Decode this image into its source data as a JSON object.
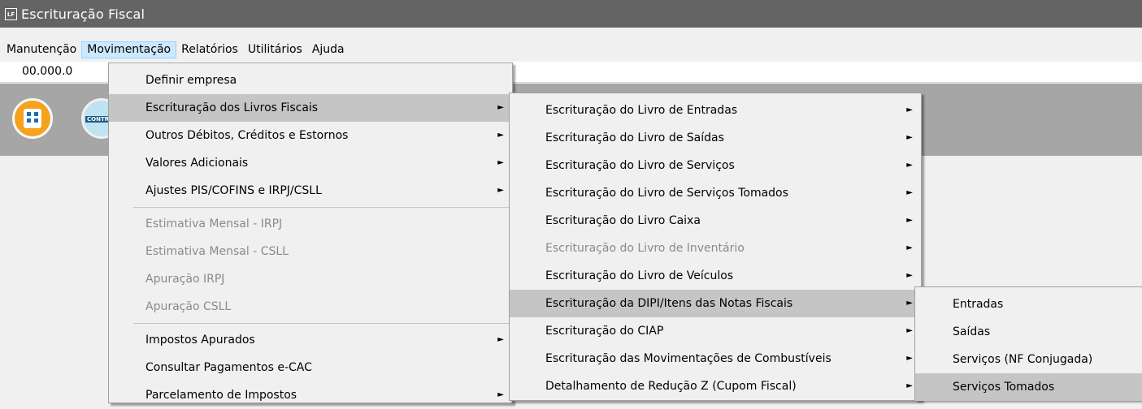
{
  "window": {
    "title": "Escrituração Fiscal",
    "icon_label": "LF"
  },
  "menubar": [
    "Manutenção",
    "Movimentação",
    "Relatórios",
    "Utilitários",
    "Ajuda"
  ],
  "company": {
    "cnpj_partial": "00.000.0"
  },
  "menu_movimentacao": [
    {
      "label": "Definir empresa",
      "submenu": false,
      "disabled": false
    },
    {
      "label": "Escrituração dos Livros Fiscais",
      "submenu": true,
      "disabled": false,
      "highlighted": true
    },
    {
      "label": "Outros Débitos, Créditos e Estornos",
      "submenu": true,
      "disabled": false
    },
    {
      "label": "Valores Adicionais",
      "submenu": true,
      "disabled": false
    },
    {
      "label": "Ajustes PIS/COFINS e IRPJ/CSLL",
      "submenu": true,
      "disabled": false
    },
    {
      "label": "Estimativa Mensal - IRPJ",
      "submenu": false,
      "disabled": true
    },
    {
      "label": "Estimativa Mensal - CSLL",
      "submenu": false,
      "disabled": true
    },
    {
      "label": "Apuração IRPJ",
      "submenu": false,
      "disabled": true
    },
    {
      "label": "Apuração CSLL",
      "submenu": false,
      "disabled": true
    },
    {
      "label": "Impostos Apurados",
      "submenu": true,
      "disabled": false
    },
    {
      "label": "Consultar Pagamentos e-CAC",
      "submenu": false,
      "disabled": false
    },
    {
      "label": "Parcelamento de Impostos",
      "submenu": true,
      "disabled": false
    }
  ],
  "menu_livros": [
    {
      "label": "Escrituração do Livro de Entradas",
      "submenu": true,
      "disabled": false
    },
    {
      "label": "Escrituração do Livro de Saídas",
      "submenu": true,
      "disabled": false
    },
    {
      "label": "Escrituração do Livro de Serviços",
      "submenu": true,
      "disabled": false
    },
    {
      "label": "Escrituração do Livro de Serviços Tomados",
      "submenu": true,
      "disabled": false
    },
    {
      "label": "Escrituração do Livro Caixa",
      "submenu": true,
      "disabled": false
    },
    {
      "label": "Escrituração do Livro de Inventário",
      "submenu": true,
      "disabled": true
    },
    {
      "label": "Escrituração do Livro de Veículos",
      "submenu": true,
      "disabled": false
    },
    {
      "label": "Escrituração da DIPI/Itens das Notas Fiscais",
      "submenu": true,
      "disabled": false,
      "highlighted": true
    },
    {
      "label": "Escrituração do CIAP",
      "submenu": true,
      "disabled": false
    },
    {
      "label": "Escrituração das Movimentações de Combustíveis",
      "submenu": true,
      "disabled": false
    },
    {
      "label": "Detalhamento de Redução Z (Cupom Fiscal)",
      "submenu": true,
      "disabled": false
    }
  ],
  "menu_dipi": [
    {
      "label": "Entradas",
      "highlighted": false
    },
    {
      "label": "Saídas",
      "highlighted": false
    },
    {
      "label": "Serviços (NF Conjugada)",
      "highlighted": false
    },
    {
      "label": "Serviços Tomados",
      "highlighted": true
    }
  ],
  "icons": {
    "submenu_arrow": "►"
  }
}
